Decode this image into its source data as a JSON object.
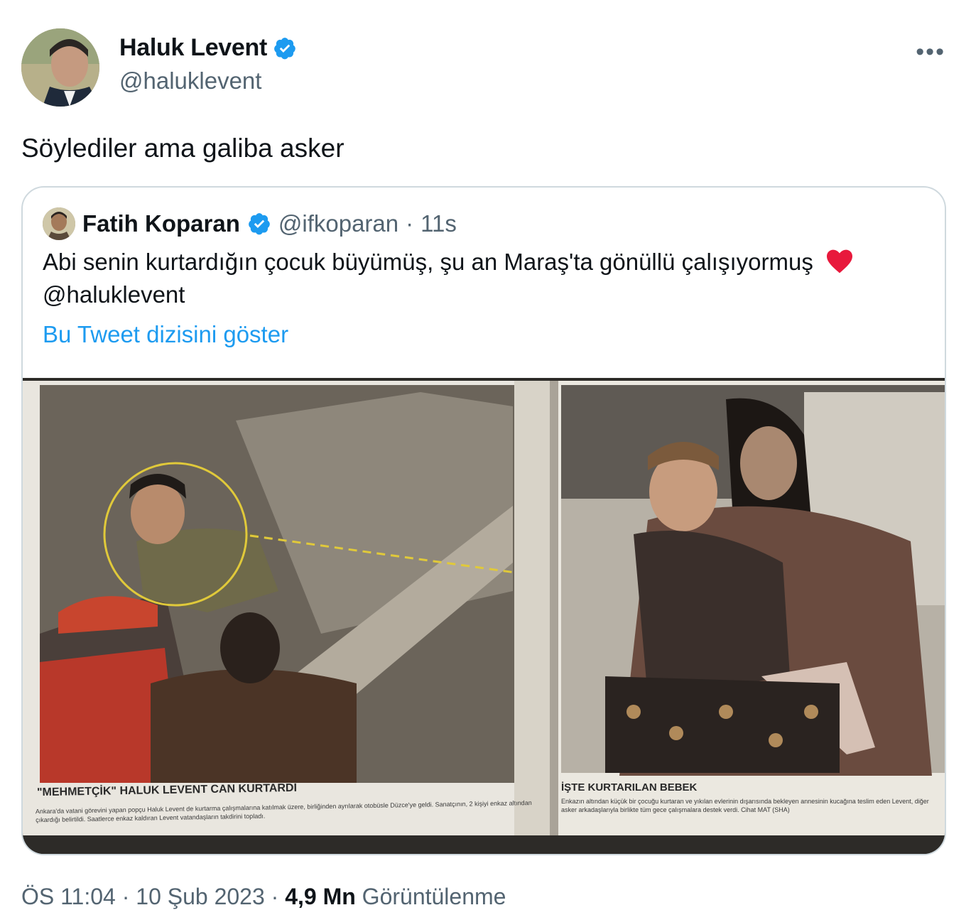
{
  "author": {
    "name": "Haluk Levent",
    "handle": "@haluklevent"
  },
  "more_label": "•••",
  "tweet_text": "Söylediler ama galiba asker",
  "quoted_tweet": {
    "name": "Fatih Koparan",
    "handle": "@ifkoparan",
    "separator": "·",
    "time": "11s",
    "text_line1": "Abi senin kurtardığın çocuk büyümüş, şu an Maraş'ta gönüllü çalışıyormuş",
    "emoji": "❤️",
    "text_line2": "@haluklevent",
    "show_thread": "Bu Tweet dizisini göster",
    "photo": {
      "left_caption_title": "\"MEHMETÇİK\" HALUK LEVENT CAN KURTARDI",
      "left_caption_body": "Ankara'da vatani görevini yapan popçu Haluk Levent de kurtarma çalışmalarına katılmak üzere, birliğinden ayrılarak otobüsle Düzce'ye geldi. Sanatçının, 2 kişiyi enkaz altından çıkardığı belirtildi. Saatlerce enkaz kaldıran Levent vatandaşların takdirini topladı.",
      "right_caption_title": "İŞTE KURTARILAN BEBEK",
      "right_caption_body": "Enkazın altından küçük bir çocuğu kurtaran ve yıkılan evlerinin dışarısında bekleyen annesinin kucağına teslim eden Levent, diğer asker arkadaşlarıyla birlikte tüm gece çalışmalara destek verdi. Cihat MAT (SHA)"
    }
  },
  "footer": {
    "time": "ÖS 11:04",
    "date": "10 Şub 2023",
    "views_count": "4,9 Mn",
    "views_label": "Görüntülenme",
    "dot": "·"
  },
  "colors": {
    "link": "#1d9bf0",
    "muted": "#536471",
    "verified": "#1d9bf0",
    "heart": "#f91880"
  }
}
